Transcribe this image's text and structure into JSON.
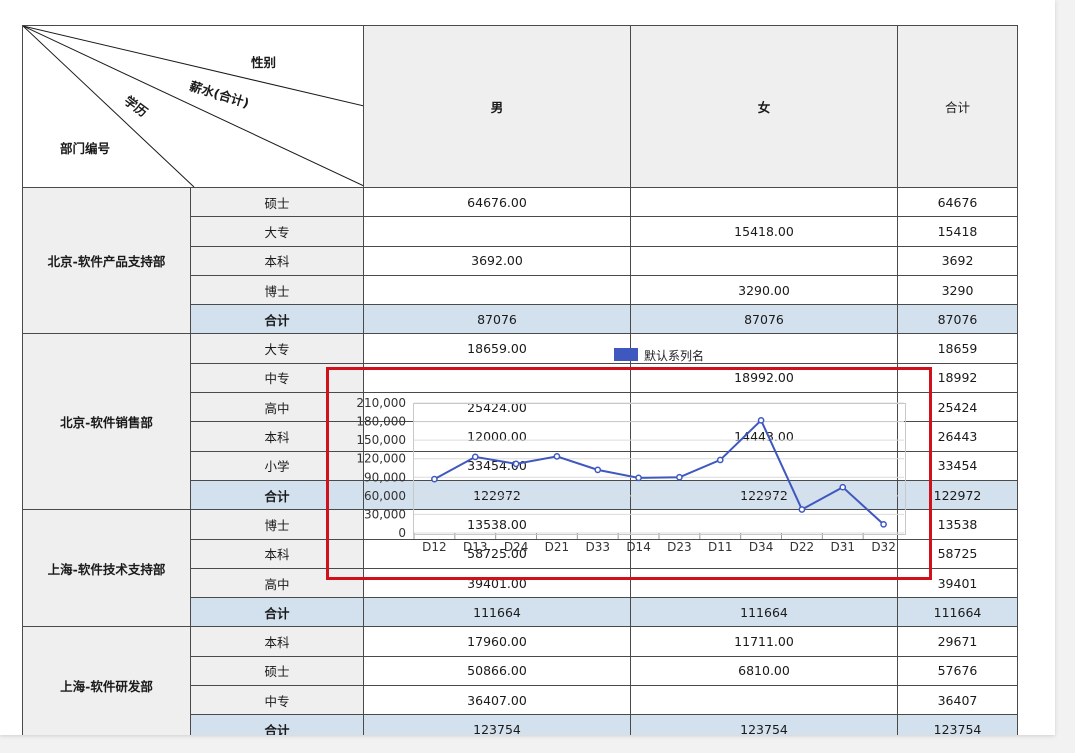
{
  "header": {
    "corner": {
      "gender": "性别",
      "salary": "薪水(合计)",
      "education": "学历",
      "department": "部门编号"
    },
    "columns": [
      "男",
      "女",
      "合计"
    ]
  },
  "groups": [
    {
      "dept": "北京-软件产品支持部",
      "rows": [
        {
          "edu": "硕士",
          "male": "64676.00",
          "female": "",
          "total": "64676"
        },
        {
          "edu": "大专",
          "male": "",
          "female": "15418.00",
          "total": "15418"
        },
        {
          "edu": "本科",
          "male": "3692.00",
          "female": "",
          "total": "3692"
        },
        {
          "edu": "博士",
          "male": "",
          "female": "3290.00",
          "total": "3290"
        }
      ],
      "subtotal": {
        "edu": "合计",
        "male": "87076",
        "female": "87076",
        "total": "87076"
      }
    },
    {
      "dept": "北京-软件销售部",
      "rows": [
        {
          "edu": "大专",
          "male": "18659.00",
          "female": "",
          "total": "18659"
        },
        {
          "edu": "中专",
          "male": "",
          "female": "18992.00",
          "total": "18992"
        },
        {
          "edu": "高中",
          "male": "25424.00",
          "female": "",
          "total": "25424"
        },
        {
          "edu": "本科",
          "male": "12000.00",
          "female": "14443.00",
          "total": "26443"
        },
        {
          "edu": "小学",
          "male": "33454.00",
          "female": "",
          "total": "33454"
        }
      ],
      "subtotal": {
        "edu": "合计",
        "male": "122972",
        "female": "122972",
        "total": "122972"
      }
    },
    {
      "dept": "上海-软件技术支持部",
      "rows": [
        {
          "edu": "博士",
          "male": "13538.00",
          "female": "",
          "total": "13538"
        },
        {
          "edu": "本科",
          "male": "58725.00",
          "female": "",
          "total": "58725"
        },
        {
          "edu": "高中",
          "male": "39401.00",
          "female": "",
          "total": "39401"
        }
      ],
      "subtotal": {
        "edu": "合计",
        "male": "111664",
        "female": "111664",
        "total": "111664"
      }
    },
    {
      "dept": "上海-软件研发部",
      "rows": [
        {
          "edu": "本科",
          "male": "17960.00",
          "female": "11711.00",
          "total": "29671"
        },
        {
          "edu": "硕士",
          "male": "50866.00",
          "female": "6810.00",
          "total": "57676"
        },
        {
          "edu": "中专",
          "male": "36407.00",
          "female": "",
          "total": "36407"
        }
      ],
      "subtotal": {
        "edu": "合计",
        "male": "123754",
        "female": "123754",
        "total": "123754"
      }
    }
  ],
  "chart_data": {
    "type": "line",
    "title": "",
    "categories": [
      "D12",
      "D13",
      "D24",
      "D21",
      "D33",
      "D14",
      "D23",
      "D11",
      "D34",
      "D22",
      "D31",
      "D32"
    ],
    "series": [
      {
        "name": "默认系列名",
        "values": [
          87076,
          122972,
          111664,
          123754,
          102000,
          89000,
          90000,
          118000,
          182000,
          38000,
          74000,
          14000
        ],
        "color": "#3f58bf"
      }
    ],
    "yticks": [
      "210,000",
      "180,000",
      "150,000",
      "120,000",
      "90,000",
      "60,000",
      "30,000",
      "0"
    ],
    "ylim": [
      0,
      210000
    ],
    "grid": true,
    "legend": "top"
  },
  "colors": {
    "highlight": "#d0101a",
    "subtotal_bg": "#d3e0ee",
    "header_bg": "#efefef",
    "series": "#3f58bf"
  }
}
